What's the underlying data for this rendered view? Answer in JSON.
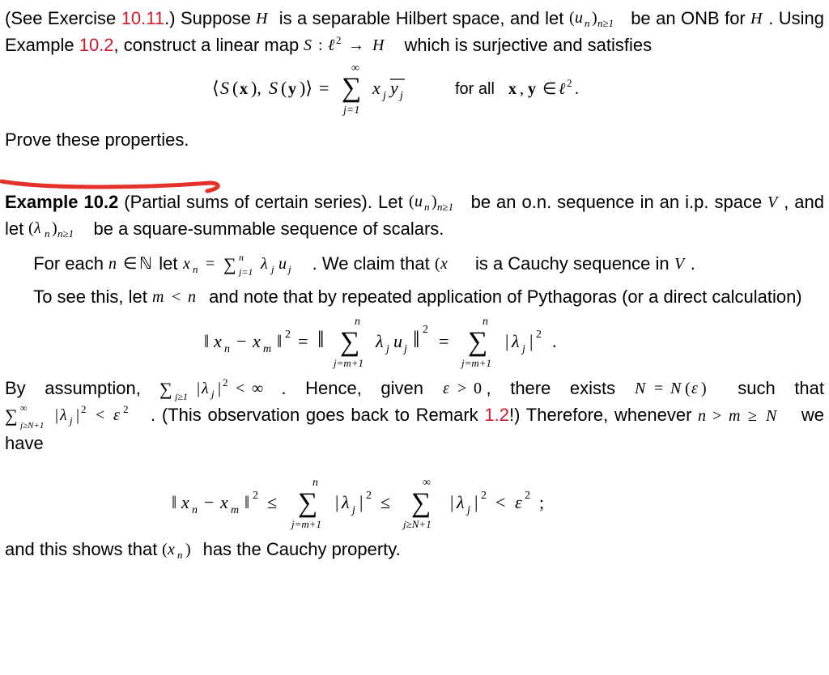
{
  "links": {
    "exercise_10_11": "10.11",
    "example_10_2_ref": "10.2",
    "remark_1_2": "1.2"
  },
  "p1": {
    "t1": "(See Exercise ",
    "t2": ".) Suppose ",
    "t3": " is a separable Hilbert space, and let ",
    "t4": " be an ONB for ",
    "t5": ". Using Example ",
    "t6": ", construct a linear map ",
    "t7": " which is surjective and satisfies"
  },
  "eq1": {
    "lhs": "⟨S(𝐱), S(𝐲)⟩ = ∑_{j=1}^{∞} x_j \\overline{y_j}",
    "cond": "for all 𝐱, 𝐲 ∈ ℓ²."
  },
  "p2": "Prove these properties.",
  "ex": {
    "label": "Example 10.2",
    "title": " (Partial sums of certain series)",
    "dot": ". ",
    "t1": "Let ",
    "t2": " be an o.n. sequence in an i.p. space ",
    "t3": ", and let ",
    "t4": " be a square-summable sequence of scalars."
  },
  "p3": {
    "t1": "For each ",
    "t2": " let ",
    "t3": ". We claim that ",
    "t4": " is a Cauchy sequence in ",
    "dot": "."
  },
  "p4": {
    "t1": "To see this, let ",
    "t2": " and note that by repeated application of Pythagoras (or a direct calculation)"
  },
  "eq2_desc": "‖x_n − x_m‖² = ‖ ∑_{j=m+1}^{n} λ_j u_j ‖² = ∑_{j=m+1}^{n} |λ_j|² .",
  "p5": {
    "t1": "By assumption, ",
    "t2": ". Hence, given ",
    "t3": ", there exists ",
    "t4": " such that ",
    "t5": ". (This observation goes back to Remark ",
    "t6": "!) Therefore, whenever ",
    "t7": " we have"
  },
  "eq3_desc": "‖x_n − x_m‖² ≤ ∑_{j=m+1}^{n} |λ_j|² ≤ ∑_{j≥N+1}^{∞} |λ_j|² < ε² ;",
  "p6": {
    "t1": "and this shows that ",
    "t2": " has the Cauchy property."
  },
  "sym": {
    "H": "H",
    "un_n_ge1": "(uₙ)_{n≥1}",
    "S_map": "S : ℓ² → H",
    "V": "V",
    "lam_n_ge1": "(λₙ)_{n≥1}",
    "n_in_N": "n ∈ ℕ",
    "xn_def": "x_n = ∑_{j=1}^{n} λ_j u_j",
    "xn_seq": "(xₙ)",
    "m_lt_n": "m < n",
    "sum_finite": "∑_{j≥1} |λ_j|² < ∞",
    "eps_gt0": "ε > 0",
    "N_eq": "N = N(ε)",
    "tail_sum": "∑_{j≥N+1}^{∞} |λ_j|² < ε²",
    "nmN": "n > m ≥ N"
  }
}
